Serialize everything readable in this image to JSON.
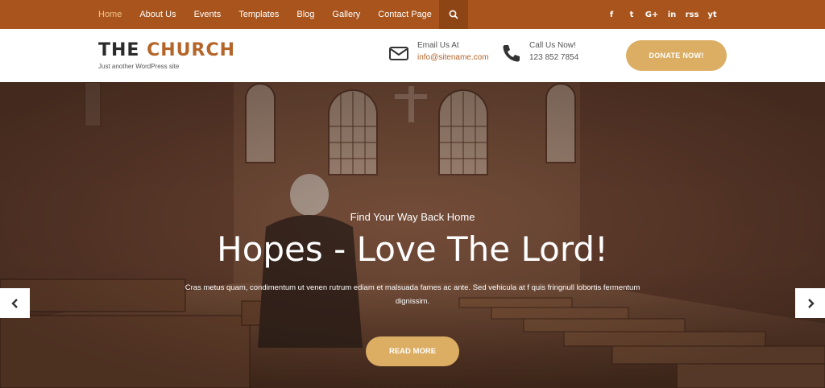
{
  "nav": {
    "items": [
      "Home",
      "About Us",
      "Events",
      "Templates",
      "Blog",
      "Gallery",
      "Contact Page"
    ],
    "active_index": 0
  },
  "social_icons": [
    "facebook-icon",
    "twitter-icon",
    "google-plus-icon",
    "linkedin-icon",
    "rss-icon",
    "youtube-icon"
  ],
  "social_glyphs": [
    "f",
    "t",
    "G+",
    "in",
    "rss",
    "yt"
  ],
  "header": {
    "logo_part1": "THE ",
    "logo_part2": "CHURCH",
    "tagline": "Just another WordPress site",
    "email_label": "Email Us At",
    "email_value": "info@sitename.com",
    "phone_label": "Call Us Now!",
    "phone_value": "123 852 7854",
    "donate_label": "DONATE NOW!"
  },
  "hero": {
    "subtitle": "Find Your Way Back Home",
    "title": "Hopes - Love The Lord!",
    "text": "Cras metus quam, condimentum ut venen rutrum ediam et malsuada fames ac ante. Sed vehicula at f quis fringnull lobortis fermentum dignissim.",
    "button_label": "READ MORE"
  },
  "colors": {
    "topbar": "#a8541c",
    "accent": "#b5652a",
    "button": "#dcae64"
  }
}
